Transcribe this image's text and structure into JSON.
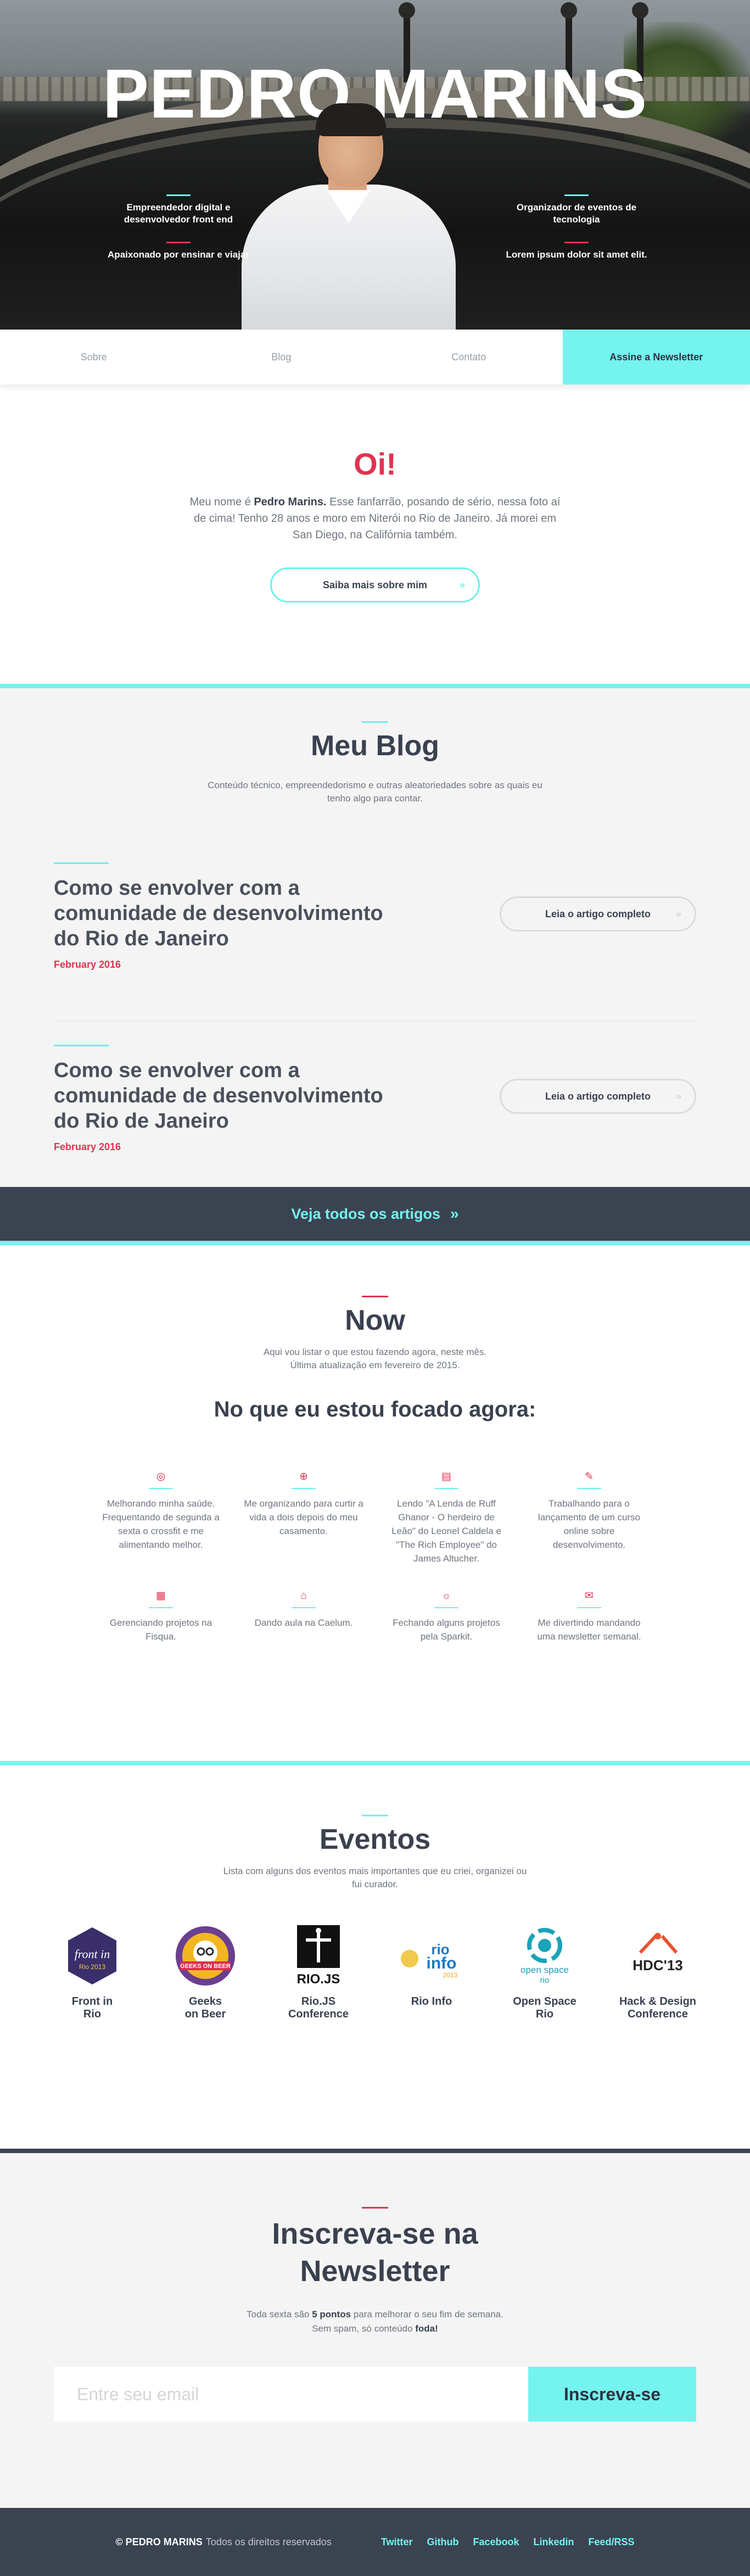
{
  "hero": {
    "name": "PEDRO MARINS",
    "tags": [
      {
        "text": "Empreendedor digital e desenvolvedor front end",
        "color": "#6ff0ec"
      },
      {
        "text": "Apaixonado por ensinar e viajar",
        "color": "#e0334f"
      },
      {
        "text": "Organizador de eventos de tecnologia",
        "color": "#6ff0ec"
      },
      {
        "text": "Lorem ipsum dolor sit amet elit.",
        "color": "#e0334f"
      }
    ]
  },
  "nav": {
    "items": [
      "Sobre",
      "Blog",
      "Contato"
    ],
    "cta": "Assine a Newsletter"
  },
  "about": {
    "title": "Oi!",
    "intro_prefix": "Meu nome é ",
    "intro_name": "Pedro Marins.",
    "intro_rest": " Esse fanfarrão, posando de sério, nessa foto aí de cima! Tenho 28 anos e moro em Niterói no Rio de Janeiro. Já morei em San Diego, na Califórnia também.",
    "button": "Saiba mais sobre mim",
    "button_icon": "»"
  },
  "blog": {
    "title": "Meu Blog",
    "subtitle": "Conteúdo técnico, empreendedorismo e outras aleatoriedades sobre as quais eu tenho algo para contar.",
    "posts": [
      {
        "title": "Como se envolver com a comunidade de desenvolvimento do Rio de Janeiro",
        "date": "February 2016",
        "button": "Leia o artigo completo"
      },
      {
        "title": "Como se envolver com a comunidade de desenvolvimento do Rio de Janeiro",
        "date": "February 2016",
        "button": "Leia o artigo completo"
      }
    ],
    "read_icon": "»",
    "all_posts": "Veja todos os artigos",
    "all_posts_icon": "»"
  },
  "now": {
    "title": "Now",
    "subtitle_line1": "Aqui vou listar o que estou fazendo agora, neste mês.",
    "subtitle_line2": "Última atualização em fevereiro de 2015.",
    "focus_title": "No que eu estou focado agora:",
    "items": [
      {
        "icon": "target-icon",
        "glyph": "◎",
        "text": "Melhorando minha saúde. Frequentando de segunda a sexta o crossfit e me alimentando melhor."
      },
      {
        "icon": "globe-icon",
        "glyph": "⊕",
        "text": "Me organizando para curtir a vida a dois depois do meu casamento."
      },
      {
        "icon": "book-icon",
        "glyph": "▤",
        "text": "Lendo \"A Lenda de Ruff Ghanor - O herdeiro de Leão\" do Leonel Caldela e \"The Rich Employee\" do James Altucher."
      },
      {
        "icon": "edit-icon",
        "glyph": "✎",
        "text": "Trabalhando para o lançamento de um curso online sobre desenvolvimento."
      },
      {
        "icon": "document-icon",
        "glyph": "▦",
        "text": "Gerenciando projetos na Fisqua."
      },
      {
        "icon": "graduation-cap-icon",
        "glyph": "⌂",
        "text": "Dando aula na Caelum."
      },
      {
        "icon": "lightbulb-icon",
        "glyph": "☼",
        "text": "Fechando alguns projetos pela Sparkit."
      },
      {
        "icon": "mail-icon",
        "glyph": "✉",
        "text": "Me divertindo mandando uma newsletter semanal."
      }
    ]
  },
  "events": {
    "title": "Eventos",
    "subtitle": "Lista com alguns dos eventos mais importantes que eu criei, organizei ou fui curador.",
    "items": [
      {
        "name_line1": "Front in",
        "name_line2": "Rio",
        "logo": "front-in-rio-logo",
        "logo_text": "front in Rio 2013"
      },
      {
        "name_line1": "Geeks",
        "name_line2": "on Beer",
        "logo": "geeks-on-beer-logo",
        "logo_text": "GEEKS ON BEER"
      },
      {
        "name_line1": "Rio.JS",
        "name_line2": "Conference",
        "logo": "riojs-logo",
        "logo_text": "RIO.JS"
      },
      {
        "name_line1": "Rio Info",
        "name_line2": "",
        "logo": "rio-info-logo",
        "logo_text": "rio info 2013"
      },
      {
        "name_line1": "Open Space",
        "name_line2": "Rio",
        "logo": "open-space-rio-logo",
        "logo_text": "open space rio"
      },
      {
        "name_line1": "Hack & Design",
        "name_line2": "Conference",
        "logo": "hdc-logo",
        "logo_text": "HDC'13"
      }
    ]
  },
  "newsletter": {
    "title_line1": "Inscreva-se na",
    "title_line2": "Newsletter",
    "text_prefix": "Toda sexta são ",
    "text_bold": "5 pontos",
    "text_rest": " para melhorar o seu fim de semana.",
    "text2_prefix": "Sem spam, só conteúdo ",
    "text2_bold": "foda!",
    "placeholder": "Entre seu email",
    "button": "Inscreva-se"
  },
  "footer": {
    "copyright": "© PEDRO MARINS",
    "rights": "Todos os direitos reservados",
    "links": [
      "Twitter",
      "Github",
      "Facebook",
      "Linkedin",
      "Feed/RSS"
    ]
  },
  "colors": {
    "accent": "#74f3ef",
    "red": "#e0334f",
    "dark": "#3b4351"
  }
}
